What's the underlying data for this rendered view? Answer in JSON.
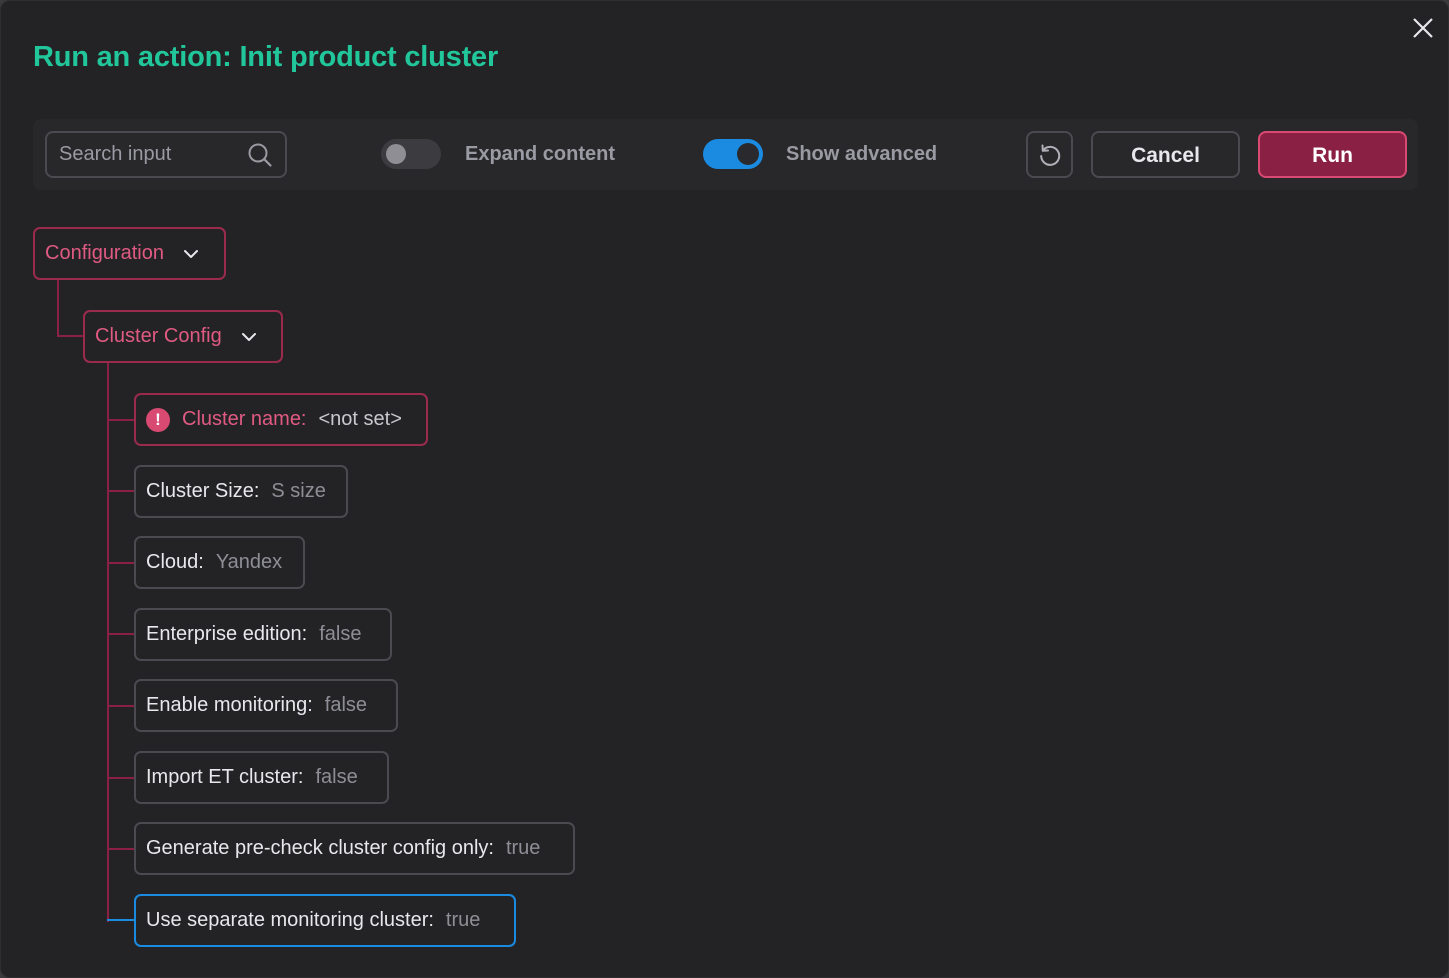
{
  "dialog": {
    "title": "Run an action: Init product cluster"
  },
  "toolbar": {
    "search_placeholder": "Search input",
    "search_value": "",
    "expand_content": {
      "label": "Expand content",
      "checked": false
    },
    "show_advanced": {
      "label": "Show advanced",
      "checked": true
    },
    "cancel_label": "Cancel",
    "run_label": "Run"
  },
  "tree": {
    "root": {
      "label": "Configuration"
    },
    "group": {
      "label": "Cluster Config"
    },
    "fields": [
      {
        "label": "Cluster name:",
        "value": "<not set>",
        "state": "error"
      },
      {
        "label": "Cluster Size:",
        "value": "S size",
        "state": "normal"
      },
      {
        "label": "Cloud:",
        "value": "Yandex",
        "state": "normal"
      },
      {
        "label": "Enterprise edition:",
        "value": "false",
        "state": "normal"
      },
      {
        "label": "Enable monitoring:",
        "value": "false",
        "state": "normal"
      },
      {
        "label": "Import ET cluster:",
        "value": "false",
        "state": "normal"
      },
      {
        "label": "Generate pre-check cluster config only:",
        "value": "true",
        "state": "normal"
      },
      {
        "label": "Use separate monitoring cluster:",
        "value": "true",
        "state": "selected"
      }
    ],
    "error_icon_glyph": "!"
  },
  "colors": {
    "title": "#21c79a",
    "accent_red": "#8a2043",
    "accent_pink": "#e05a82",
    "accent_blue": "#1a8be0",
    "background": "#232325"
  }
}
